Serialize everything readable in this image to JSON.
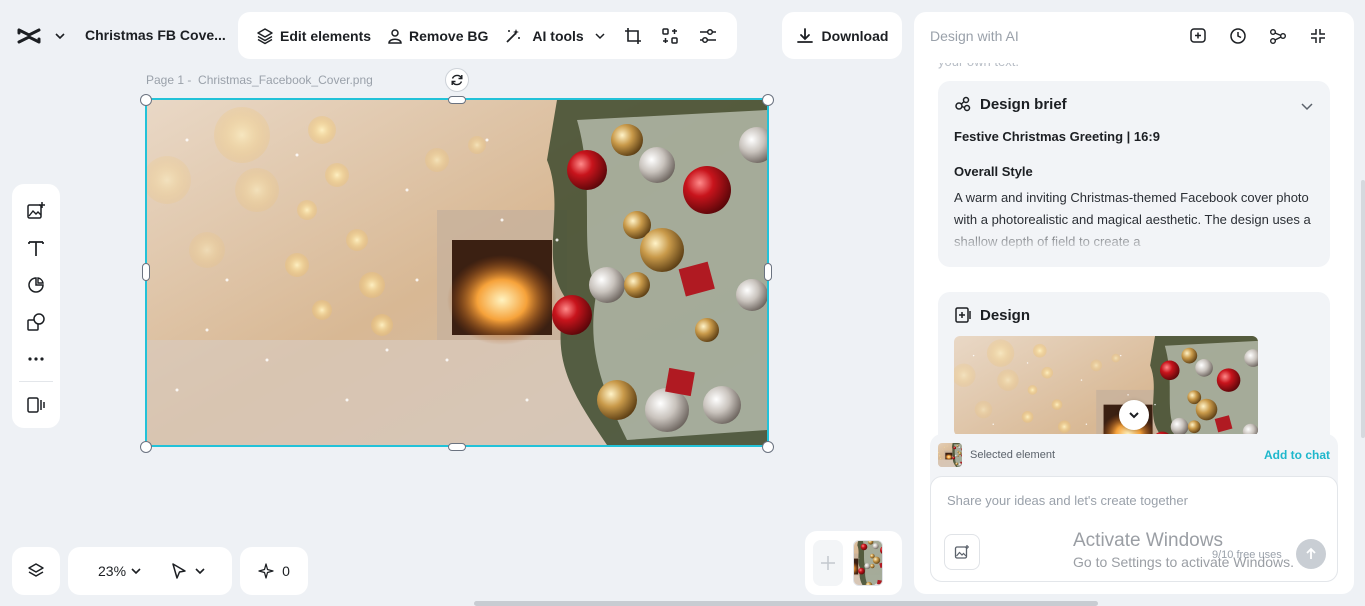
{
  "app": {
    "doc_title": "Christmas FB Cove...",
    "logo_icon": "capcut-logo-icon"
  },
  "toolbar": {
    "edit_elements": "Edit elements",
    "remove_bg": "Remove BG",
    "ai_tools": "AI tools",
    "download": "Download"
  },
  "canvas": {
    "page_label": "Page 1 -",
    "file_name": "Christmas_Facebook_Cover.png"
  },
  "bottom_bar": {
    "zoom": "23%",
    "points": "0"
  },
  "right_panel": {
    "title": "Design with AI",
    "cutoff_text": "your own text.",
    "brief": {
      "title": "Design brief",
      "heading": "Festive Christmas Greeting | 16:9",
      "style_heading": "Overall Style",
      "style_body": "A warm and inviting Christmas-themed Facebook cover photo with a photorealistic and magical aesthetic. The design uses a shallow depth of field to create a"
    },
    "design": {
      "title": "Design"
    },
    "chat": {
      "selected_label": "Selected element",
      "add_to_chat": "Add to chat",
      "placeholder": "Share your ideas and let's create together",
      "free_uses": "9/10 free uses"
    }
  },
  "overlay": {
    "activate_title": "Activate Windows",
    "activate_sub": "Go to Settings to activate Windows."
  },
  "colors": {
    "accent": "#22c2d8",
    "link": "#1fb7cc",
    "panel_bg": "#f2f4f7",
    "page_bg": "#eef1f5"
  }
}
